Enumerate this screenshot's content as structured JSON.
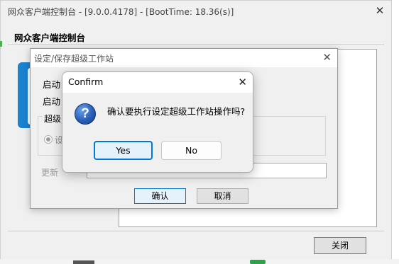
{
  "main_window": {
    "title": "网众客户端控制台 - [9.0.0.4178] - [BootTime: 18.36(s)]",
    "header": "网众客户端控制台",
    "close_icon": "✕",
    "close_button_label": "关闭"
  },
  "save_dialog": {
    "title": "设定/保存超级工作站",
    "close_icon": "✕",
    "label_line1": "启动",
    "label_line2": "启动",
    "group_title": "超级",
    "radio_label": "设",
    "update_label": "更新",
    "ok_label": "确认",
    "cancel_label": "取消"
  },
  "confirm_dialog": {
    "title": "Confirm",
    "close_icon": "✕",
    "icon_glyph": "?",
    "message": "确认要执行设定超级工作站操作吗?",
    "yes_label": "Yes",
    "no_label": "No"
  },
  "colors": {
    "accent": "#0078d7",
    "tile_blue": "#1a82d0",
    "question_icon": "#2a5fb8"
  }
}
